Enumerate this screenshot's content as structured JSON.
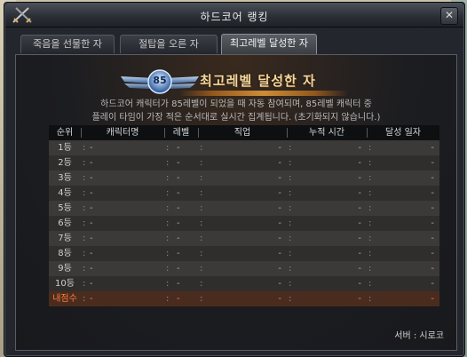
{
  "window": {
    "title": "하드코어 랭킹",
    "close_glyph": "✕"
  },
  "tabs": [
    {
      "label": "죽음을 선물한 자",
      "active": false
    },
    {
      "label": "절탑을 오른 자",
      "active": false
    },
    {
      "label": "최고레벨 달성한 자",
      "active": true
    }
  ],
  "banner": {
    "emblem_number": "85",
    "title": "최고레벨 달성한 자",
    "description_line1": "하드코어 캐릭터가 85레벨이 되었을 때 자동 참여되며, 85레벨 캐릭터 중",
    "description_line2": "플레이 타임이 가장 적은 순서대로 실시간 집계됩니다. (초기화되지 않습니다.)"
  },
  "table": {
    "headers": [
      "순위",
      "캐릭터명",
      "레벨",
      "직업",
      "누적 시간",
      "달성 일자"
    ],
    "rows": [
      {
        "rank": "1등",
        "name": "-",
        "level": "-",
        "job": "-",
        "time": "-",
        "date": "-"
      },
      {
        "rank": "2등",
        "name": "-",
        "level": "-",
        "job": "-",
        "time": "-",
        "date": "-"
      },
      {
        "rank": "3등",
        "name": "-",
        "level": "-",
        "job": "-",
        "time": "-",
        "date": "-"
      },
      {
        "rank": "4등",
        "name": "-",
        "level": "-",
        "job": "-",
        "time": "-",
        "date": "-"
      },
      {
        "rank": "5등",
        "name": "-",
        "level": "-",
        "job": "-",
        "time": "-",
        "date": "-"
      },
      {
        "rank": "6등",
        "name": "-",
        "level": "-",
        "job": "-",
        "time": "-",
        "date": "-"
      },
      {
        "rank": "7등",
        "name": "-",
        "level": "-",
        "job": "-",
        "time": "-",
        "date": "-"
      },
      {
        "rank": "8등",
        "name": "-",
        "level": "-",
        "job": "-",
        "time": "-",
        "date": "-"
      },
      {
        "rank": "9등",
        "name": "-",
        "level": "-",
        "job": "-",
        "time": "-",
        "date": "-"
      },
      {
        "rank": "10등",
        "name": "-",
        "level": "-",
        "job": "-",
        "time": "-",
        "date": "-"
      }
    ],
    "my_row": {
      "rank": "내점수",
      "name": "-",
      "level": "-",
      "job": "-",
      "time": "-",
      "date": "-"
    }
  },
  "footer": {
    "server": "서버 : 시로코"
  },
  "colors": {
    "accent": "#ffb040",
    "my_score": "#ff7a3a"
  }
}
